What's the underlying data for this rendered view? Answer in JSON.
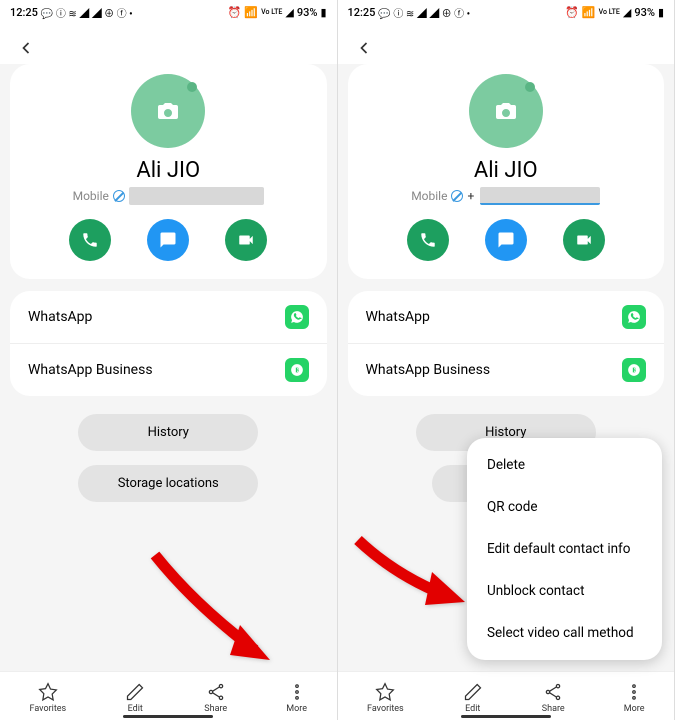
{
  "status": {
    "time": "12:25",
    "battery": "93%",
    "lte": "Vo LTE"
  },
  "contact": {
    "name": "Ali JIO",
    "phone_label": "Mobile",
    "plus": "+"
  },
  "apps": {
    "whatsapp": "WhatsApp",
    "business": "WhatsApp Business"
  },
  "chips": {
    "history": "History",
    "storage": "Storage locations"
  },
  "chips_truncated": {
    "storage": "Sto"
  },
  "nav": {
    "favorites": "Favorites",
    "edit": "Edit",
    "share": "Share",
    "more": "More"
  },
  "menu": {
    "items": [
      "Delete",
      "QR code",
      "Edit default contact info",
      "Unblock contact",
      "Select video call method"
    ]
  }
}
